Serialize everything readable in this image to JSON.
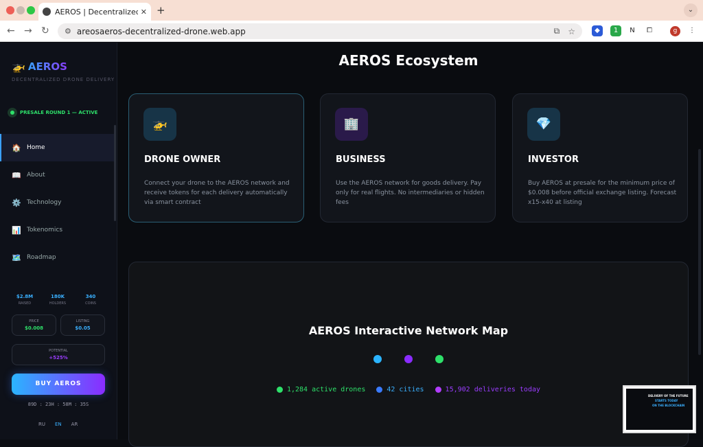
{
  "browser": {
    "tab_title": "AEROS | Decentralized Drone",
    "tab_close": "✕",
    "new_tab": "+",
    "url": "areosaeros-decentralized-drone.web.app",
    "profile_initial": "g",
    "extension_badge": "1"
  },
  "sidebar": {
    "brand_icon": "helicopter-icon",
    "brand_name": "AEROS",
    "brand_subtitle": "DECENTRALIZED DRONE DELIVERY",
    "presale_status": "PRESALE ROUND 1 — ACTIVE",
    "menu": [
      {
        "label": "Home",
        "icon": "🏠"
      },
      {
        "label": "About",
        "icon": "📖"
      },
      {
        "label": "Technology",
        "icon": "⚙️"
      },
      {
        "label": "Tokenomics",
        "icon": "📊"
      },
      {
        "label": "Roadmap",
        "icon": "🗺️"
      }
    ],
    "stats": [
      {
        "value": "$2.8M",
        "label": "RAISED"
      },
      {
        "value": "180K",
        "label": "HOLDERS"
      },
      {
        "value": "340",
        "label": "COINS"
      }
    ],
    "price": {
      "label": "PRICE",
      "value": "$0.008"
    },
    "listing": {
      "label": "LISTING",
      "value": "$0.05"
    },
    "potential": {
      "label": "POTENTIAL",
      "value": "+525%"
    },
    "buy_button": "BUY AEROS",
    "countdown": "89D : 23H : 58M : 35S",
    "languages": [
      "RU",
      "EN",
      "AR"
    ],
    "active_language": "EN"
  },
  "main": {
    "title": "AEROS Ecosystem",
    "cards": [
      {
        "icon": "🚁",
        "title": "DRONE OWNER",
        "description": "Connect your drone to the AEROS network and receive tokens for each delivery automatically via smart contract"
      },
      {
        "icon": "🏢",
        "title": "BUSINESS",
        "description": "Use the AEROS network for goods delivery. Pay only for real flights. No intermediaries or hidden fees"
      },
      {
        "icon": "💎",
        "title": "INVESTOR",
        "description": "Buy AEROS at presale for the minimum price of $0.008 before official exchange listing. Forecast x15-x40 at listing"
      }
    ],
    "map": {
      "title": "AEROS Interactive Network Map",
      "stats": [
        {
          "text": "1,284 active drones",
          "color": "#2ee06a"
        },
        {
          "text": "42 cities",
          "color": "#3ab0ff"
        },
        {
          "text": "15,902 deliveries today",
          "color": "#9b3dff"
        }
      ]
    }
  },
  "thumbnail": {
    "line1": "DELIVERY OF THE FUTURE",
    "line2": "STARTS TODAY",
    "line3": "ON THE BLOCKCHAIN"
  },
  "colors": {
    "accent_blue": "#3ab0ff",
    "accent_purple": "#8a2cff",
    "accent_green": "#2ee06a"
  }
}
